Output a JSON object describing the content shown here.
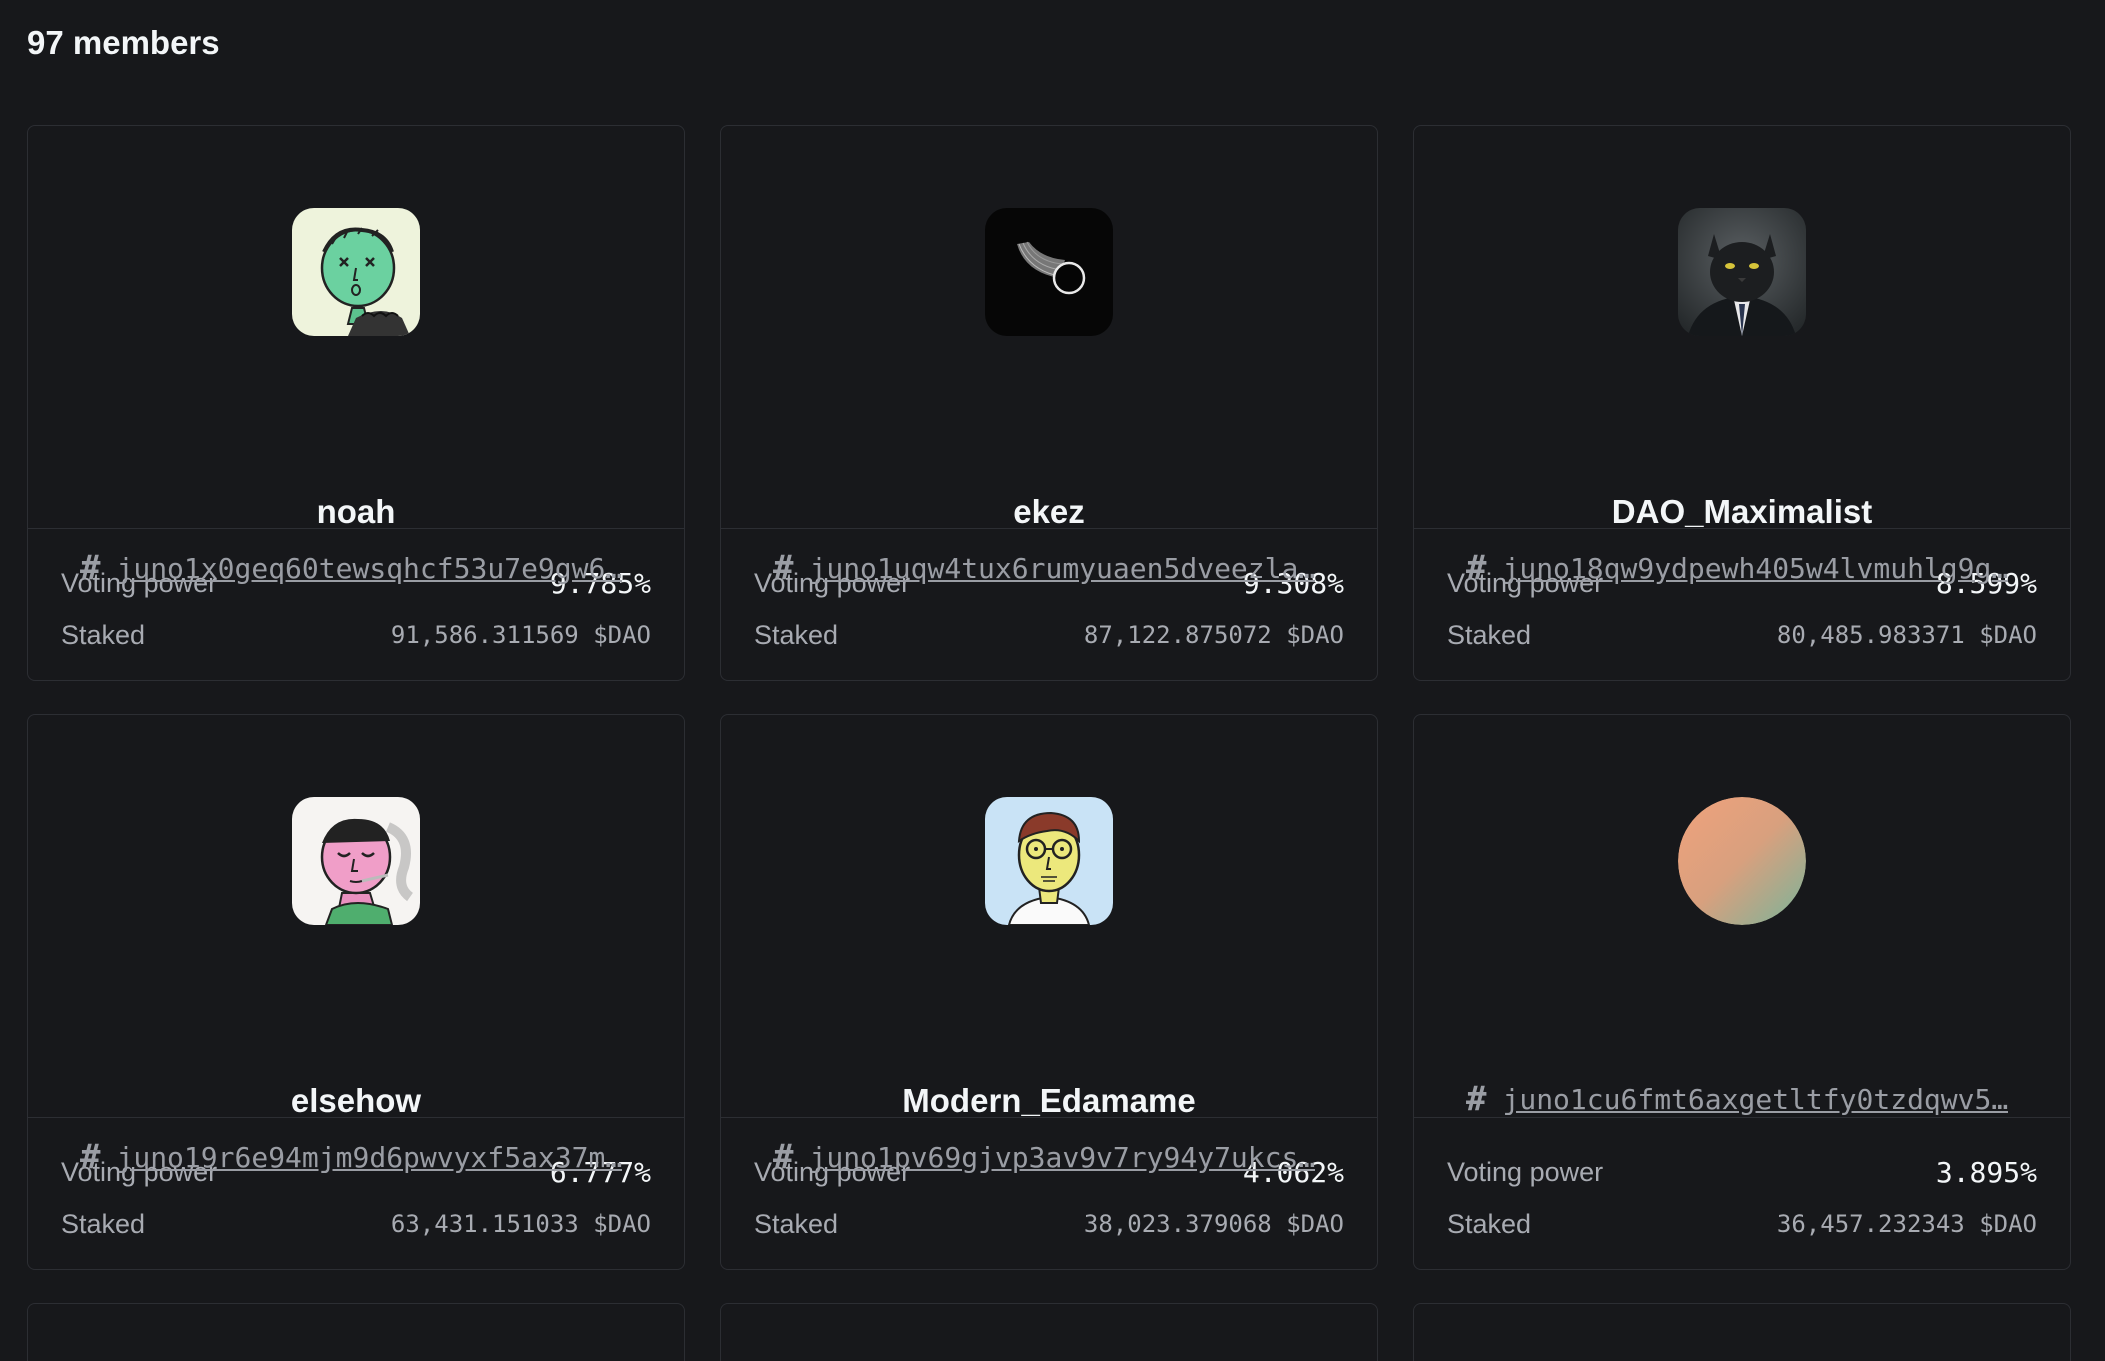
{
  "header": {
    "member_count": "97 members"
  },
  "labels": {
    "voting_power": "Voting power",
    "staked": "Staked"
  },
  "members": [
    {
      "name": "noah",
      "address": "juno1x0geq60tewsqhcf53u7e9gw6…",
      "voting_power": "9.785%",
      "staked": "91,586.311569 $DAO",
      "avatar_icon": "sketch-green-face-avatar"
    },
    {
      "name": "ekez",
      "address": "juno1uqw4tux6rumyuaen5dveezla…",
      "voting_power": "9.308%",
      "staked": "87,122.875072 $DAO",
      "avatar_icon": "black-abstract-avatar"
    },
    {
      "name": "DAO_Maximalist",
      "address": "juno18qw9ydpewh405w4lvmuhlg9g…",
      "voting_power": "8.599%",
      "staked": "80,485.983371 $DAO",
      "avatar_icon": "cat-in-suit-avatar"
    },
    {
      "name": "elsehow",
      "address": "juno19r6e94mjm9d6pwvyxf5ax37m…",
      "voting_power": "6.777%",
      "staked": "63,431.151033 $DAO",
      "avatar_icon": "sketch-pink-face-avatar"
    },
    {
      "name": "Modern_Edamame",
      "address": "juno1pv69gjvp3av9v7ry94y7ukcs…",
      "voting_power": "4.062%",
      "staked": "38,023.379068 $DAO",
      "avatar_icon": "sketch-glasses-face-avatar"
    },
    {
      "name": "",
      "address": "juno1cu6fmt6axgetltfy0tzdqwv5…",
      "voting_power": "3.895%",
      "staked": "36,457.232343 $DAO",
      "avatar_icon": "gradient-circle-avatar"
    }
  ]
}
